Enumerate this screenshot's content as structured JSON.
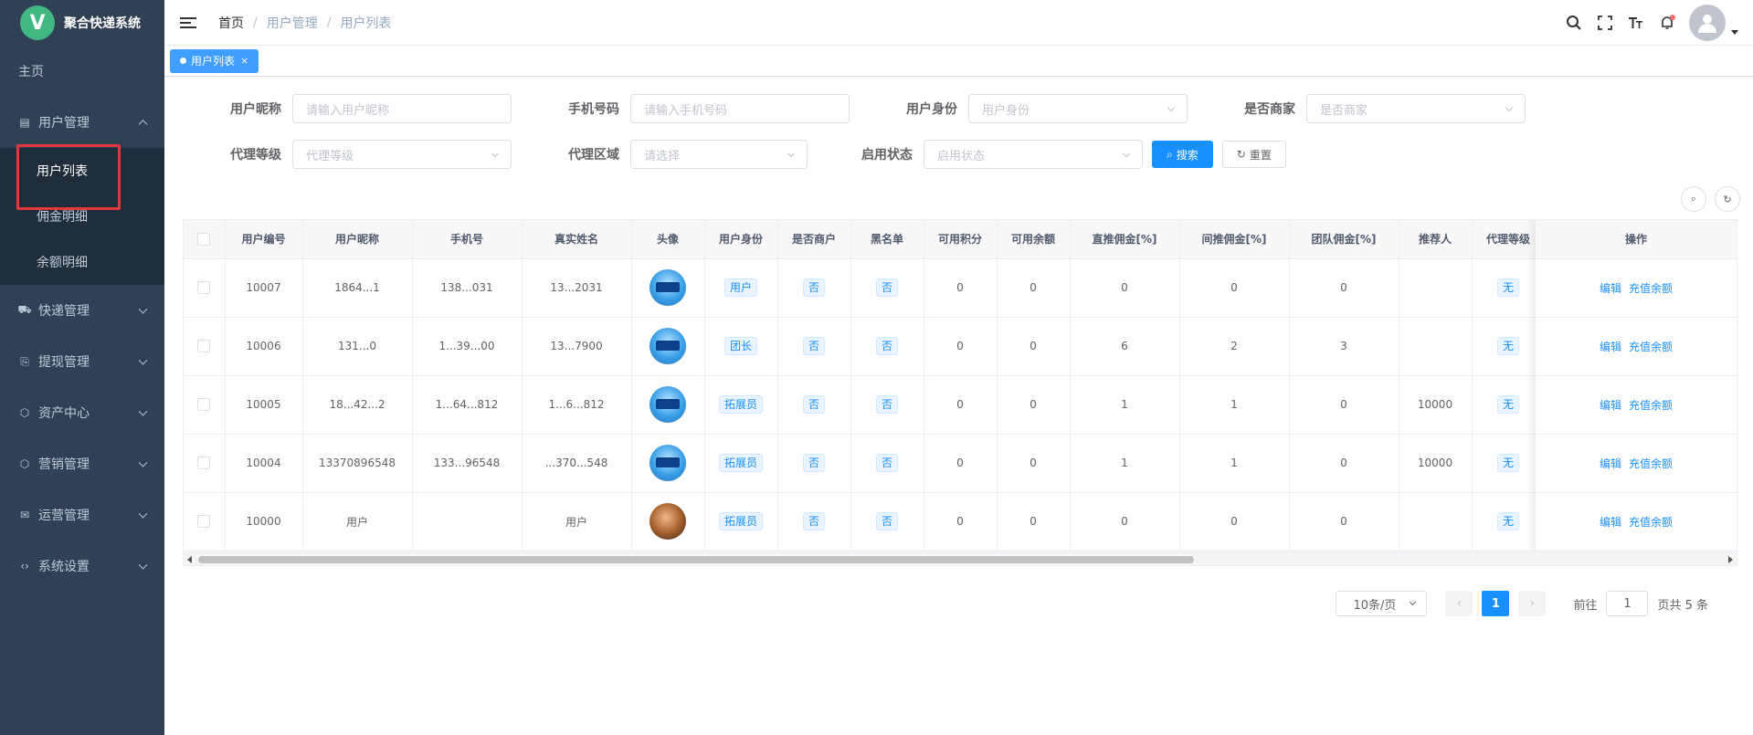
{
  "app": {
    "logo_letter": "V",
    "title": "聚合快递系统"
  },
  "sidebar": {
    "home": "主页",
    "user_mgmt": {
      "label": "用户管理",
      "icon": "list-icon",
      "children": [
        "用户列表",
        "佣金明细",
        "余额明细"
      ]
    },
    "groups": [
      {
        "label": "快递管理",
        "icon": "express-icon"
      },
      {
        "label": "提现管理",
        "icon": "withdraw-icon"
      },
      {
        "label": "资产中心",
        "icon": "cube-icon"
      },
      {
        "label": "营销管理",
        "icon": "cube-icon"
      },
      {
        "label": "运营管理",
        "icon": "mail-icon"
      },
      {
        "label": "系统设置",
        "icon": "code-icon"
      }
    ]
  },
  "header": {
    "breadcrumb": [
      "首页",
      "用户管理",
      "用户列表"
    ],
    "icons": [
      "search-icon",
      "fullscreen-icon",
      "font-size-icon",
      "bell-icon",
      "avatar"
    ]
  },
  "tags": {
    "active": "用户列表",
    "close": "×"
  },
  "filters": {
    "nickname": {
      "label": "用户昵称",
      "placeholder": "请输入用户昵称"
    },
    "phone": {
      "label": "手机号码",
      "placeholder": "请输入手机号码"
    },
    "identity": {
      "label": "用户身份",
      "placeholder": "用户身份"
    },
    "is_merchant": {
      "label": "是否商家",
      "placeholder": "是否商家"
    },
    "agent_level": {
      "label": "代理等级",
      "placeholder": "代理等级"
    },
    "agent_region": {
      "label": "代理区域",
      "placeholder": "请选择"
    },
    "enabled": {
      "label": "启用状态",
      "placeholder": "启用状态"
    },
    "search_btn": "搜索",
    "reset_btn": "重置"
  },
  "table": {
    "columns": [
      "用户编号",
      "用户昵称",
      "手机号",
      "真实姓名",
      "头像",
      "用户身份",
      "是否商户",
      "黑名单",
      "可用积分",
      "可用余额",
      "直推佣金[%]",
      "间推佣金[%]",
      "团队佣金[%]",
      "推荐人",
      "代理等级",
      "操作"
    ],
    "rows": [
      {
        "id": "10007",
        "nickname": "1864...1",
        "phone": "138...031",
        "realname": "13...2031",
        "avatar": "blue",
        "identity": "用户",
        "merchant": "否",
        "blacklist": "否",
        "points": "0",
        "balance": "0",
        "direct": "0",
        "indirect": "0",
        "team": "0",
        "referrer": "",
        "agent": "无"
      },
      {
        "id": "10006",
        "nickname": "131...0",
        "phone": "1...39...00",
        "realname": "13...7900",
        "avatar": "blue",
        "identity": "团长",
        "merchant": "否",
        "blacklist": "否",
        "points": "0",
        "balance": "0",
        "direct": "6",
        "indirect": "2",
        "team": "3",
        "referrer": "",
        "agent": "无"
      },
      {
        "id": "10005",
        "nickname": "18...42...2",
        "phone": "1...64...812",
        "realname": "1...6...812",
        "avatar": "blue",
        "identity": "拓展员",
        "merchant": "否",
        "blacklist": "否",
        "points": "0",
        "balance": "0",
        "direct": "1",
        "indirect": "1",
        "team": "0",
        "referrer": "10000",
        "agent": "无"
      },
      {
        "id": "10004",
        "nickname": "13370896548",
        "phone": "133...96548",
        "realname": "...370...548",
        "avatar": "blue",
        "identity": "拓展员",
        "merchant": "否",
        "blacklist": "否",
        "points": "0",
        "balance": "0",
        "direct": "1",
        "indirect": "1",
        "team": "0",
        "referrer": "10000",
        "agent": "无"
      },
      {
        "id": "10000",
        "nickname": "用户",
        "phone": "",
        "realname": "用户",
        "avatar": "brown",
        "identity": "拓展员",
        "merchant": "否",
        "blacklist": "否",
        "points": "0",
        "balance": "0",
        "direct": "0",
        "indirect": "0",
        "team": "0",
        "referrer": "",
        "agent": "无"
      }
    ],
    "actions": [
      "编辑",
      "充值余额"
    ]
  },
  "pagination": {
    "page_size": "10条/页",
    "current": "1",
    "goto_label": "前往",
    "goto_value": "1",
    "total_label": "页共 5 条"
  },
  "colors": {
    "sidebar_bg": "#304156",
    "primary": "#1890ff",
    "highlight": "#e0393e"
  }
}
